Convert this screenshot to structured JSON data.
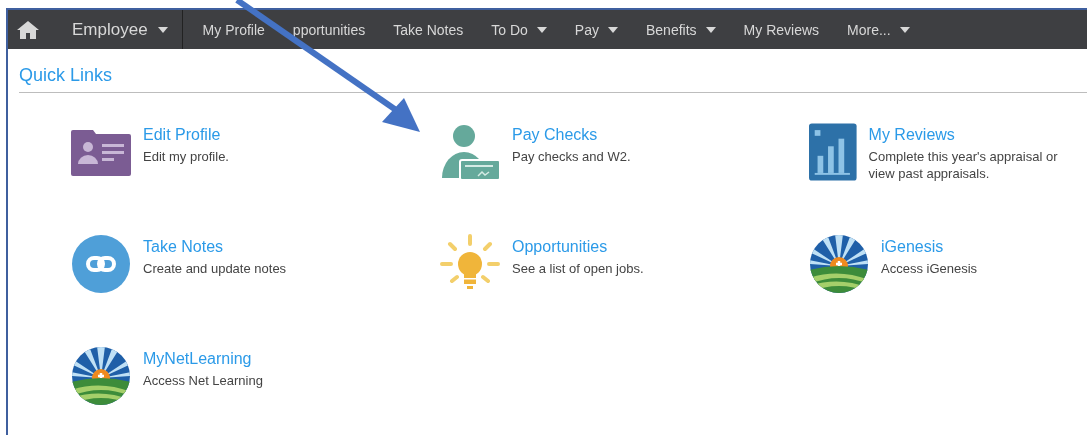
{
  "nav": {
    "home": {
      "kind": "home"
    },
    "menu": {
      "label": "Employee",
      "dropdown": true
    },
    "items": [
      {
        "label": "My Profile",
        "dropdown": false
      },
      {
        "label": "pportunities",
        "dropdown": false
      },
      {
        "label": "Take Notes",
        "dropdown": false
      },
      {
        "label": "To Do",
        "dropdown": true
      },
      {
        "label": "Pay",
        "dropdown": true
      },
      {
        "label": "Benefits",
        "dropdown": true
      },
      {
        "label": "My Reviews",
        "dropdown": false
      },
      {
        "label": "More...",
        "dropdown": true
      }
    ]
  },
  "quick_links": {
    "title": "Quick Links",
    "links": [
      {
        "title": "Edit Profile",
        "description": "Edit my profile.",
        "kind": "profile"
      },
      {
        "title": "Pay Checks",
        "description": "Pay checks and W2.",
        "kind": "paycheck"
      },
      {
        "title": "My Reviews",
        "description": "Complete this year's appraisal or view past appraisals.",
        "kind": "chart"
      },
      {
        "title": "Take Notes",
        "description": "Create and update notes",
        "kind": "link"
      },
      {
        "title": "Opportunities",
        "description": "See a list of open jobs.",
        "kind": "bulb"
      },
      {
        "title": "iGenesis",
        "description": "Access iGenesis",
        "kind": "sunrise"
      },
      {
        "title": "MyNetLearning",
        "description": "Access Net Learning",
        "kind": "sunrise"
      }
    ]
  },
  "annotation": {
    "kind": "arrow"
  }
}
